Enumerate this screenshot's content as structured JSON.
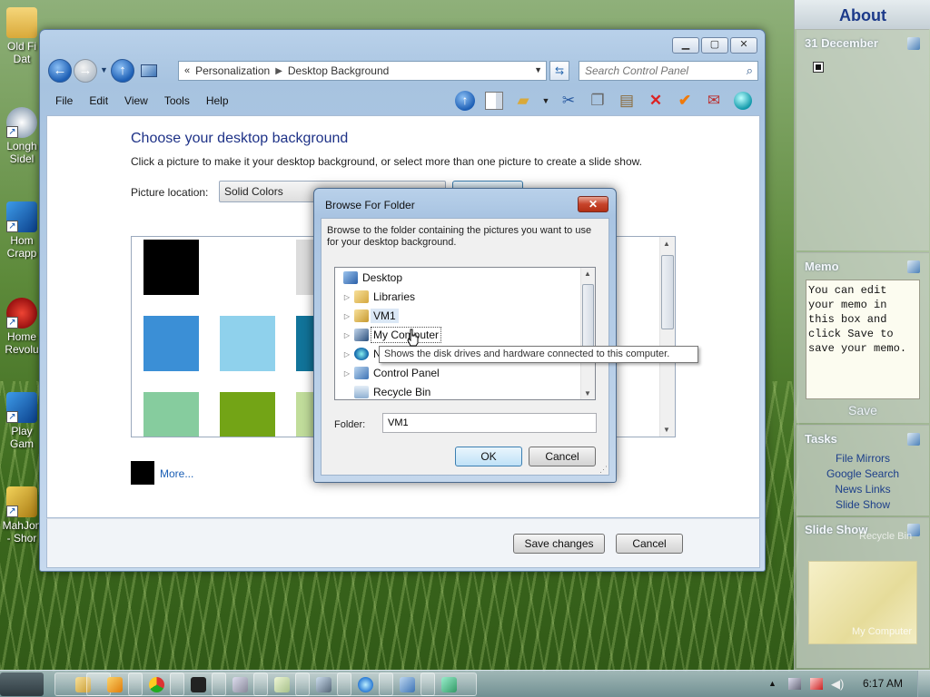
{
  "desktop": {
    "icons": [
      {
        "label": "Old Fi Dat",
        "icon": "folder-icon"
      },
      {
        "label": "Longh Sidel",
        "icon": "sidebar-icon"
      },
      {
        "label": "Hom Crapp",
        "icon": "hp-icon"
      },
      {
        "label": "Home Revolu",
        "icon": "game-icon"
      },
      {
        "label": "Play Gam",
        "icon": "hp-icon"
      },
      {
        "label": "MahJon - Shor",
        "icon": "mahjong-icon"
      }
    ]
  },
  "window": {
    "address": {
      "part1": "Personalization",
      "part2": "Desktop Background"
    },
    "search_placeholder": "Search Control Panel",
    "menu": [
      "File",
      "Edit",
      "View",
      "Tools",
      "Help"
    ],
    "heading": "Choose your desktop background",
    "description": "Click a picture to make it your desktop background, or select more than one picture to create a slide show.",
    "location_label": "Picture location:",
    "location_value": "Solid Colors",
    "more_link": "More...",
    "save_label": "Save changes",
    "cancel_label": "Cancel",
    "swatch_colors": [
      "#000000",
      "#ffffff",
      "#dcdcdc",
      "#3b8fd6",
      "#8fd1ec",
      "#11749a",
      "#86cc9e",
      "#73a416",
      "#c1dd9b"
    ]
  },
  "dialog": {
    "title": "Browse For Folder",
    "close_glyph": "✕",
    "description": "Browse to the folder containing the pictures you want to use for your desktop background.",
    "tree": [
      {
        "label": "Desktop",
        "expand": "",
        "icon": "desktop-icon"
      },
      {
        "label": "Libraries",
        "expand": "▷",
        "icon": "libraries-icon"
      },
      {
        "label": "VM1",
        "expand": "▷",
        "icon": "user-folder-icon"
      },
      {
        "label": "My Computer",
        "expand": "▷",
        "icon": "computer-icon"
      },
      {
        "label": "N",
        "expand": "▷",
        "icon": "network-icon"
      },
      {
        "label": "Control Panel",
        "expand": "▷",
        "icon": "control-panel-icon"
      },
      {
        "label": "Recycle Bin",
        "expand": "",
        "icon": "recycle-bin-icon"
      }
    ],
    "tooltip": "Shows the disk drives and hardware connected to this computer.",
    "folder_label": "Folder:",
    "folder_value": "VM1",
    "ok_label": "OK",
    "cancel_label": "Cancel"
  },
  "sidebar": {
    "header": "About",
    "date": "31 December",
    "memo_title": "Memo",
    "memo_text": "You can edit your memo in this box and click Save to save your memo.",
    "memo_save": "Save",
    "tasks_title": "Tasks",
    "tasks": [
      "File Mirrors",
      "Google Search",
      "News Links",
      "Slide Show"
    ],
    "slideshow_title": "Slide Show",
    "slideshow_caption_top": "Recycle Bin",
    "slideshow_caption_bottom": "My Computer"
  },
  "taskbar": {
    "clock": "6:17 AM",
    "buttons": [
      "explorer-icon",
      "media-player-icon",
      "chrome-icon",
      "7zip-icon",
      "calculator-icon",
      "notepad-icon",
      "app-icon",
      "ie-icon",
      "control-panel-icon",
      "network-icon"
    ]
  }
}
